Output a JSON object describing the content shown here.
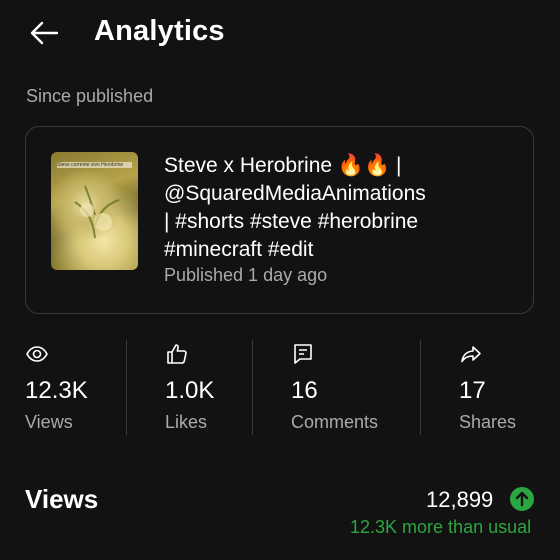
{
  "header": {
    "back_icon": "arrow-left-icon",
    "title": "Analytics"
  },
  "section_label": "Since published",
  "video": {
    "thumbnail_caption": "Steve corrente vivo Herobrine",
    "title_lines": [
      "Steve x Herobrine 🔥🔥 |",
      "@SquaredMediaAnimations",
      "| #shorts #steve #herobrine",
      "#minecraft #edit"
    ],
    "meta": "Published 1 day ago"
  },
  "stats": [
    {
      "icon": "eye-icon",
      "value": "12.3K",
      "label": "Views"
    },
    {
      "icon": "thumbs-up-icon",
      "value": "1.0K",
      "label": "Likes"
    },
    {
      "icon": "comment-icon",
      "value": "16",
      "label": "Comments"
    },
    {
      "icon": "share-icon",
      "value": "17",
      "label": "Shares"
    }
  ],
  "views_section": {
    "title": "Views",
    "number": "12,899",
    "trend_icon": "arrow-up-icon",
    "comparison": "12.3K more than usual"
  },
  "colors": {
    "background": "#121212",
    "text_primary": "#ffffff",
    "text_secondary": "#aaaaaa",
    "border": "#3a3a3a",
    "positive": "#2ba640"
  }
}
